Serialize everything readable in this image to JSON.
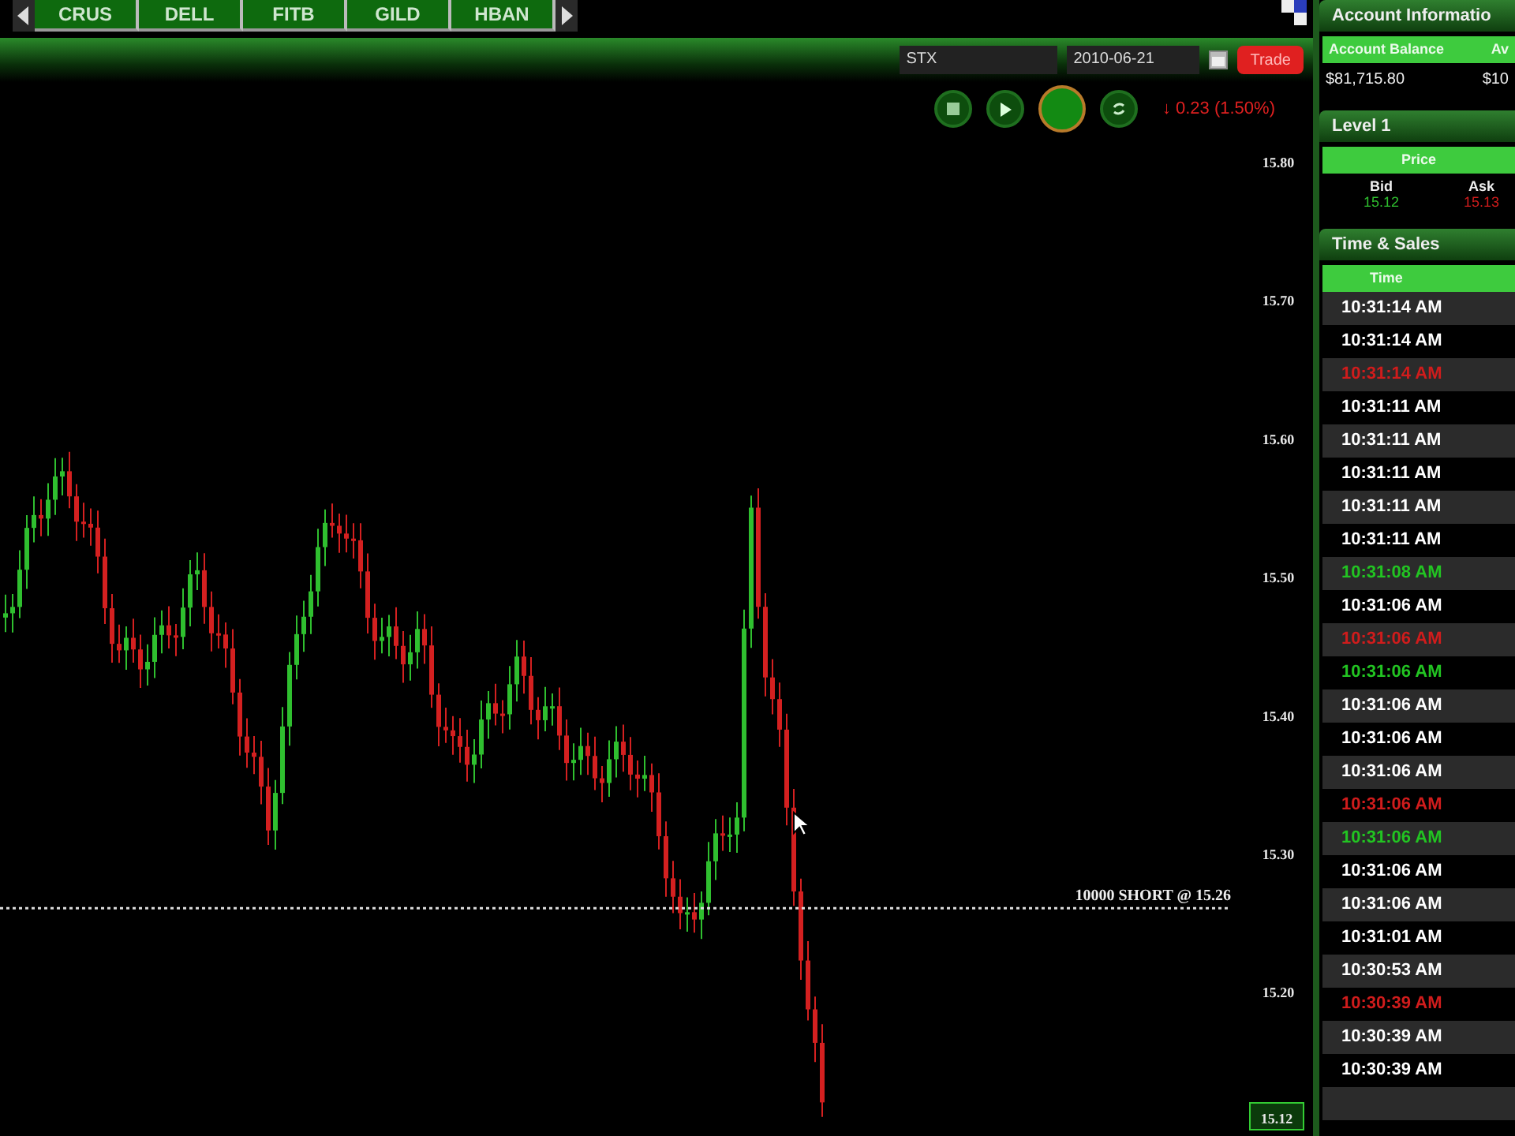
{
  "symbol_tabs": [
    "CRUS",
    "DELL",
    "FITB",
    "GILD",
    "HBAN"
  ],
  "toolbar": {
    "symbol": "STX",
    "date": "2010-06-21",
    "trade_button": "Trade"
  },
  "playback_controls": [
    {
      "kind": "pause",
      "selected": false
    },
    {
      "kind": "play",
      "selected": false
    },
    {
      "kind": "record",
      "selected": true
    },
    {
      "kind": "sync",
      "selected": false
    }
  ],
  "change": "↓ 0.23 (1.50%)",
  "chart": {
    "price_axis": [
      "15.80",
      "15.70",
      "15.60",
      "15.50",
      "15.40",
      "15.30",
      "15.20"
    ],
    "position_label": "10000 SHORT @ 15.26",
    "last_price": "15.12"
  },
  "account": {
    "title": "Account Informatio",
    "columns": [
      "Account Balance",
      "Av"
    ],
    "values": [
      "$81,715.80",
      "$10"
    ]
  },
  "level1": {
    "title": "Level 1",
    "header": "Price",
    "bid_label": "Bid",
    "ask_label": "Ask",
    "bid": "15.12",
    "ask": "15.13"
  },
  "time_sales": {
    "title": "Time & Sales",
    "column": "Time",
    "rows": [
      {
        "time": "10:31:14 AM",
        "color": "#ffffff"
      },
      {
        "time": "10:31:14 AM",
        "color": "#ffffff"
      },
      {
        "time": "10:31:14 AM",
        "color": "#d01c1c"
      },
      {
        "time": "10:31:11 AM",
        "color": "#ffffff"
      },
      {
        "time": "10:31:11 AM",
        "color": "#ffffff"
      },
      {
        "time": "10:31:11 AM",
        "color": "#ffffff"
      },
      {
        "time": "10:31:11 AM",
        "color": "#ffffff"
      },
      {
        "time": "10:31:11 AM",
        "color": "#ffffff"
      },
      {
        "time": "10:31:08 AM",
        "color": "#22c422"
      },
      {
        "time": "10:31:06 AM",
        "color": "#ffffff"
      },
      {
        "time": "10:31:06 AM",
        "color": "#d01c1c"
      },
      {
        "time": "10:31:06 AM",
        "color": "#22c422"
      },
      {
        "time": "10:31:06 AM",
        "color": "#ffffff"
      },
      {
        "time": "10:31:06 AM",
        "color": "#ffffff"
      },
      {
        "time": "10:31:06 AM",
        "color": "#ffffff"
      },
      {
        "time": "10:31:06 AM",
        "color": "#d01c1c"
      },
      {
        "time": "10:31:06 AM",
        "color": "#22c422"
      },
      {
        "time": "10:31:06 AM",
        "color": "#ffffff"
      },
      {
        "time": "10:31:06 AM",
        "color": "#ffffff"
      },
      {
        "time": "10:31:01 AM",
        "color": "#ffffff"
      },
      {
        "time": "10:30:53 AM",
        "color": "#ffffff"
      },
      {
        "time": "10:30:39 AM",
        "color": "#d01c1c"
      },
      {
        "time": "10:30:39 AM",
        "color": "#ffffff"
      },
      {
        "time": "10:30:39 AM",
        "color": "#ffffff"
      }
    ]
  }
}
